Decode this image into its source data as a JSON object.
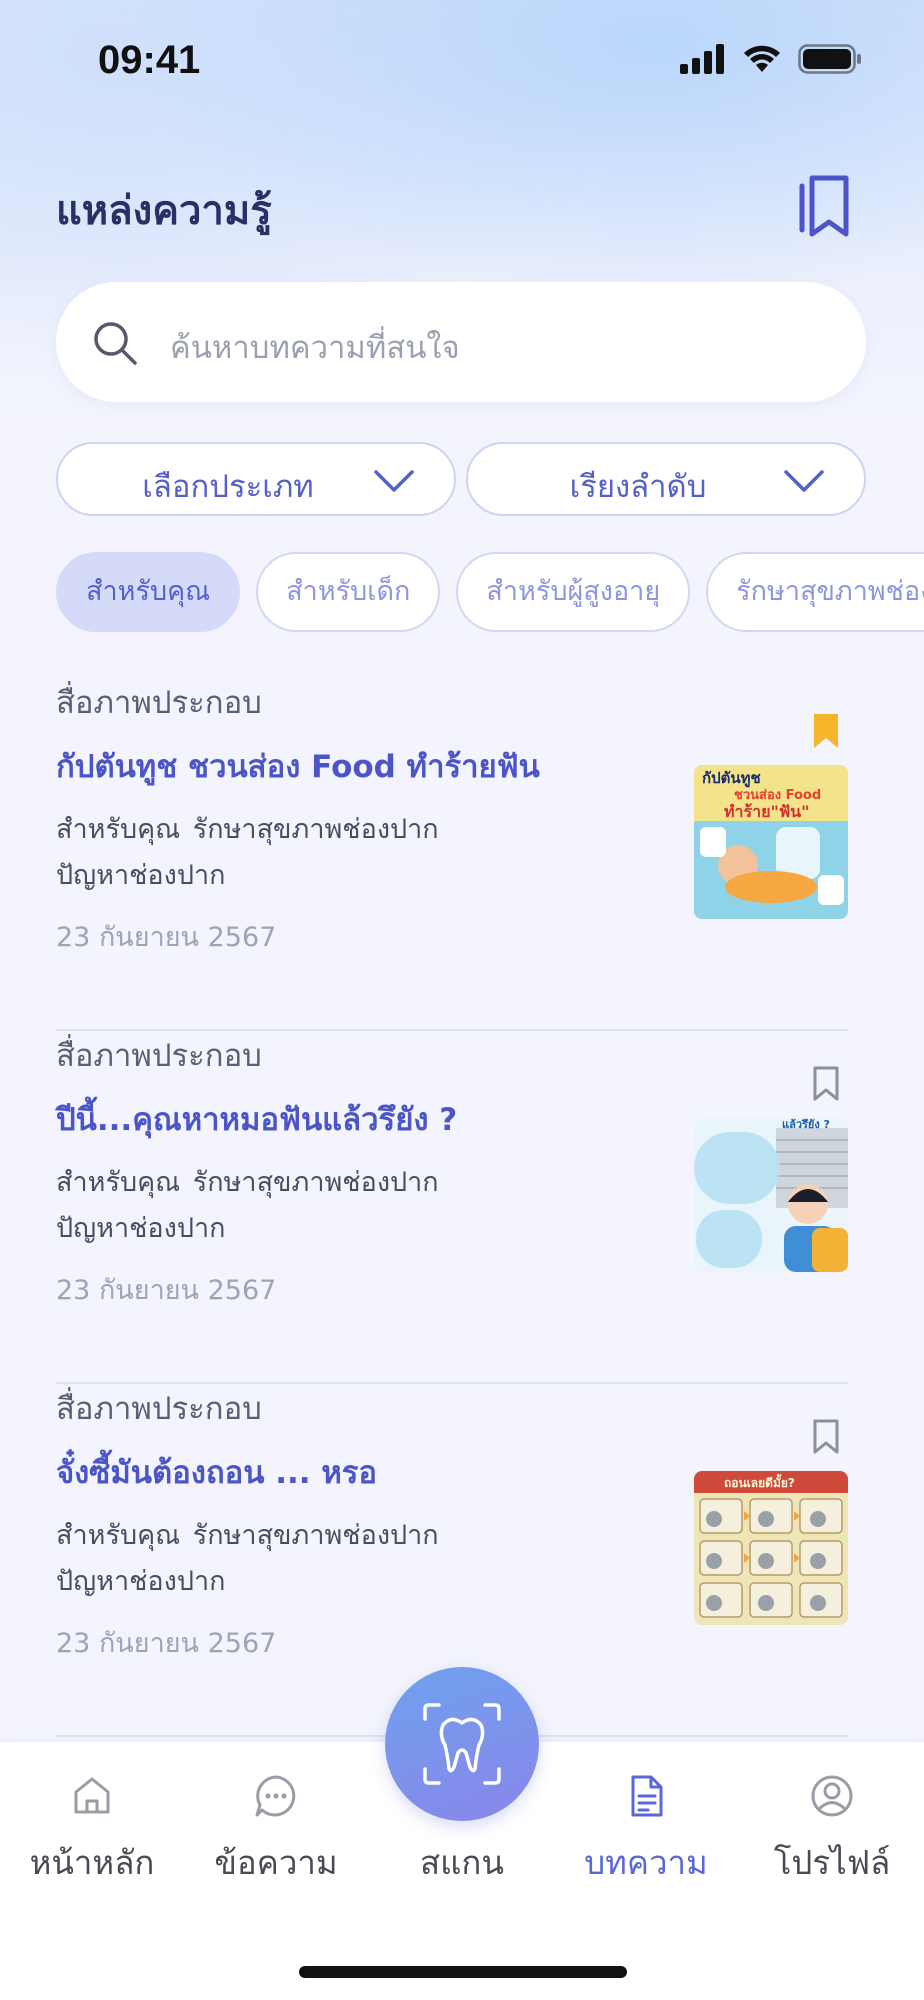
{
  "status": {
    "time": "09:41"
  },
  "header": {
    "title": "แหล่งความรู้",
    "bookmark_icon": "bookmark-double-icon"
  },
  "search": {
    "placeholder": "ค้นหาบทความที่สนใจ"
  },
  "filters": {
    "category": "เลือกประเภท",
    "sort": "เรียงลำดับ"
  },
  "chips": [
    "สำหรับคุณ",
    "สำหรับเด็ก",
    "สำหรับผู้สูงอายุ",
    "รักษาสุขภาพช่องปาก"
  ],
  "articles": [
    {
      "type": "สื่อภาพประกอบ",
      "title": "กัปตันทูช ชวนส่อง Food ทำร้ายฟัน",
      "tags1": "สำหรับคุณ  รักษาสุขภาพช่องปาก",
      "tags2": "ปัญหาช่องปาก",
      "date": "23 กันยายน 2567",
      "bookmarked": true,
      "thumb_text": [
        "กัปตันทูช",
        "ชวนส่อง Food",
        "ทำร้าย\"ฟัน\""
      ]
    },
    {
      "type": "สื่อภาพประกอบ",
      "title": "ปีนี้...คุณหาหมอฟันแล้วรึยัง ?",
      "tags1": "สำหรับคุณ  รักษาสุขภาพช่องปาก",
      "tags2": "ปัญหาช่องปาก",
      "date": "23 กันยายน 2567",
      "bookmarked": false,
      "thumb_text": [
        "แล้วรึยัง ?"
      ]
    },
    {
      "type": "สื่อภาพประกอบ",
      "title": "จั๋งซี้มันต้องถอน ... หรอ",
      "tags1": "สำหรับคุณ  รักษาสุขภาพช่องปาก",
      "tags2": "ปัญหาช่องปาก",
      "date": "23 กันยายน 2567",
      "bookmarked": false,
      "thumb_text": [
        "ถอนเลยดีมั้ย?"
      ]
    }
  ],
  "nav": [
    {
      "label": "หน้าหลัก",
      "icon": "home-icon"
    },
    {
      "label": "ข้อความ",
      "icon": "chat-icon"
    },
    {
      "label": "สแกน",
      "icon": "tooth-scan-icon"
    },
    {
      "label": "บทความ",
      "icon": "document-icon",
      "active": true
    },
    {
      "label": "โปรไฟล์",
      "icon": "profile-icon"
    }
  ],
  "colors": {
    "accent": "#5a68d6",
    "bookmark_active": "#f7b52c",
    "chip_active_bg": "#d4daf8"
  }
}
